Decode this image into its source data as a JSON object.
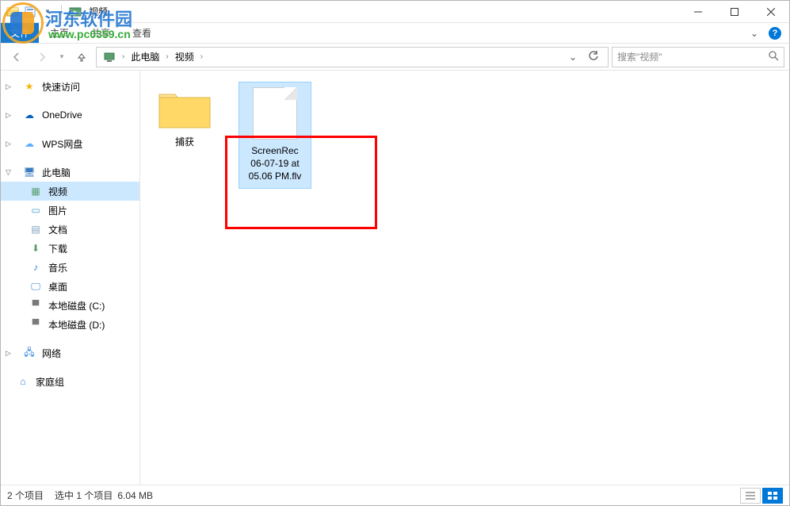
{
  "window": {
    "title": "视频"
  },
  "ribbon": {
    "file": "文件",
    "tabs": [
      "主页",
      "共享",
      "查看"
    ]
  },
  "breadcrumb": {
    "root": "此电脑",
    "current": "视频"
  },
  "search": {
    "placeholder": "搜索\"视频\""
  },
  "sidebar": {
    "quick_access": "快速访问",
    "onedrive": "OneDrive",
    "wps": "WPS网盘",
    "this_pc": "此电脑",
    "videos": "视频",
    "pictures": "图片",
    "documents": "文档",
    "downloads": "下载",
    "music": "音乐",
    "desktop": "桌面",
    "drive_c": "本地磁盘 (C:)",
    "drive_d": "本地磁盘 (D:)",
    "network": "网络",
    "homegroup": "家庭组"
  },
  "files": {
    "folder1": "捕获",
    "file1_l1": "ScreenRec",
    "file1_l2": "06-07-19 at",
    "file1_l3": "05.06 PM.flv"
  },
  "status": {
    "count": "2 个项目",
    "selection": "选中 1 个项目",
    "size": "6.04 MB"
  },
  "watermark": {
    "line1": "河东软件园",
    "line2": "www.pc0359.cn"
  }
}
